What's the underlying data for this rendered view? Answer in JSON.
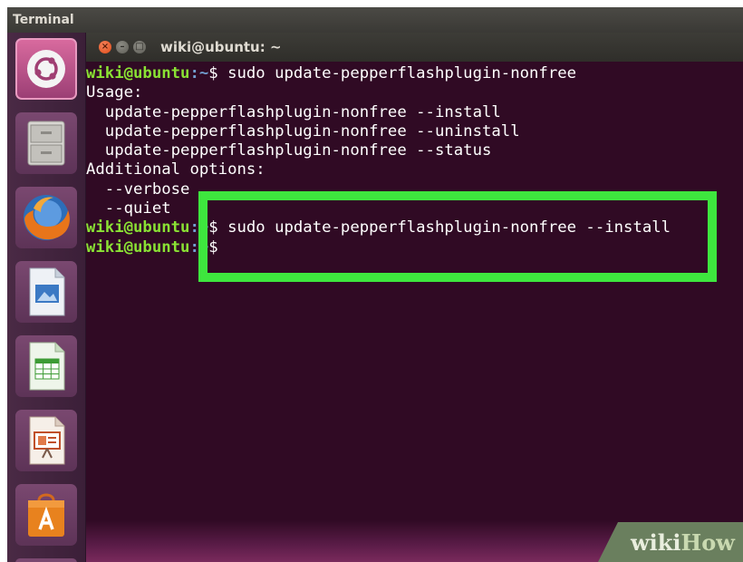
{
  "top_bar": {
    "title": "Terminal"
  },
  "window": {
    "title": "wiki@ubuntu: ~",
    "close_glyph": "×",
    "minimize_glyph": "–",
    "maximize_glyph": "□"
  },
  "terminal": {
    "lines": [
      {
        "user": "wiki@ubuntu",
        "path": ":~",
        "text": "$ sudo update-pepperflashplugin-nonfree"
      },
      {
        "text": "Usage:"
      },
      {
        "text": "  update-pepperflashplugin-nonfree --install"
      },
      {
        "text": "  update-pepperflashplugin-nonfree --uninstall"
      },
      {
        "text": "  update-pepperflashplugin-nonfree --status"
      },
      {
        "text": "Additional options:"
      },
      {
        "text": "  --verbose"
      },
      {
        "text": "  --quiet"
      },
      {
        "user": "wiki@ubuntu",
        "path": ":~",
        "text": "$ sudo update-pepperflashplugin-nonfree --install"
      },
      {
        "user": "wiki@ubuntu",
        "path": ":~",
        "text": "$"
      }
    ]
  },
  "launcher": {
    "items": [
      "dash-icon",
      "files-icon",
      "firefox-icon",
      "libreoffice-writer-icon",
      "libreoffice-calc-icon",
      "libreoffice-impress-icon",
      "software-center-icon"
    ]
  },
  "watermark": {
    "part1": "wiki",
    "part2": "How"
  },
  "colors": {
    "terminal_bg": "#300a24",
    "prompt_user": "#8ae234",
    "prompt_path": "#729fcf",
    "highlight": "#3ee63e"
  }
}
